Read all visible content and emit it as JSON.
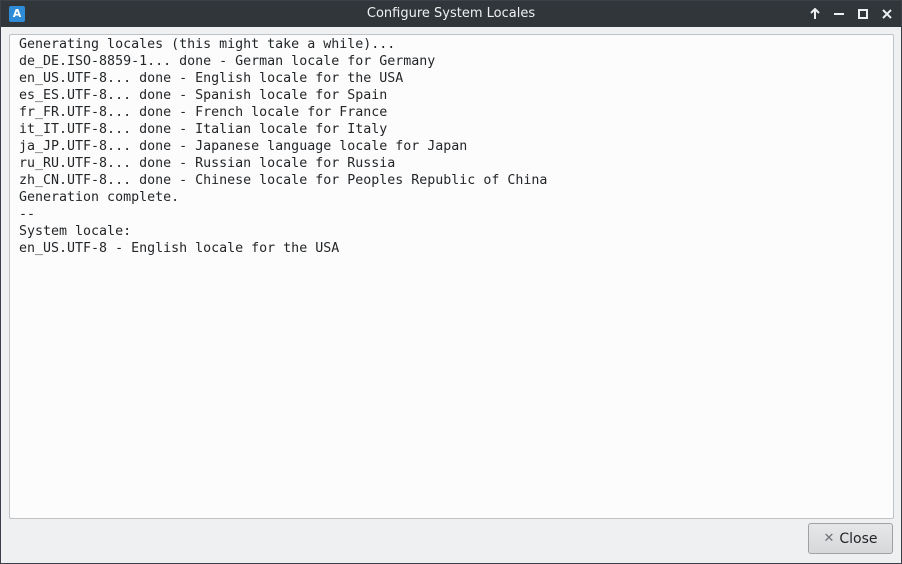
{
  "window": {
    "title": "Configure System Locales",
    "app_icon_letter": "A"
  },
  "titlebar_buttons": [
    {
      "name": "keep-above-icon"
    },
    {
      "name": "minimize-icon"
    },
    {
      "name": "maximize-icon"
    },
    {
      "name": "close-icon"
    }
  ],
  "output": {
    "lines": [
      "Generating locales (this might take a while)...",
      "de_DE.ISO-8859-1... done - German locale for Germany",
      "en_US.UTF-8... done - English locale for the USA",
      "es_ES.UTF-8... done - Spanish locale for Spain",
      "fr_FR.UTF-8... done - French locale for France",
      "it_IT.UTF-8... done - Italian locale for Italy",
      "ja_JP.UTF-8... done - Japanese language locale for Japan",
      "ru_RU.UTF-8... done - Russian locale for Russia",
      "zh_CN.UTF-8... done - Chinese locale for Peoples Republic of China",
      "Generation complete.",
      "--",
      "System locale:",
      "en_US.UTF-8 - English locale for the USA"
    ]
  },
  "footer": {
    "close_icon": "✕",
    "close_label": "Close"
  },
  "colors": {
    "titlebar": "#31363b",
    "window_bg": "#eff0f1",
    "app_icon": "#2d8bd8"
  }
}
